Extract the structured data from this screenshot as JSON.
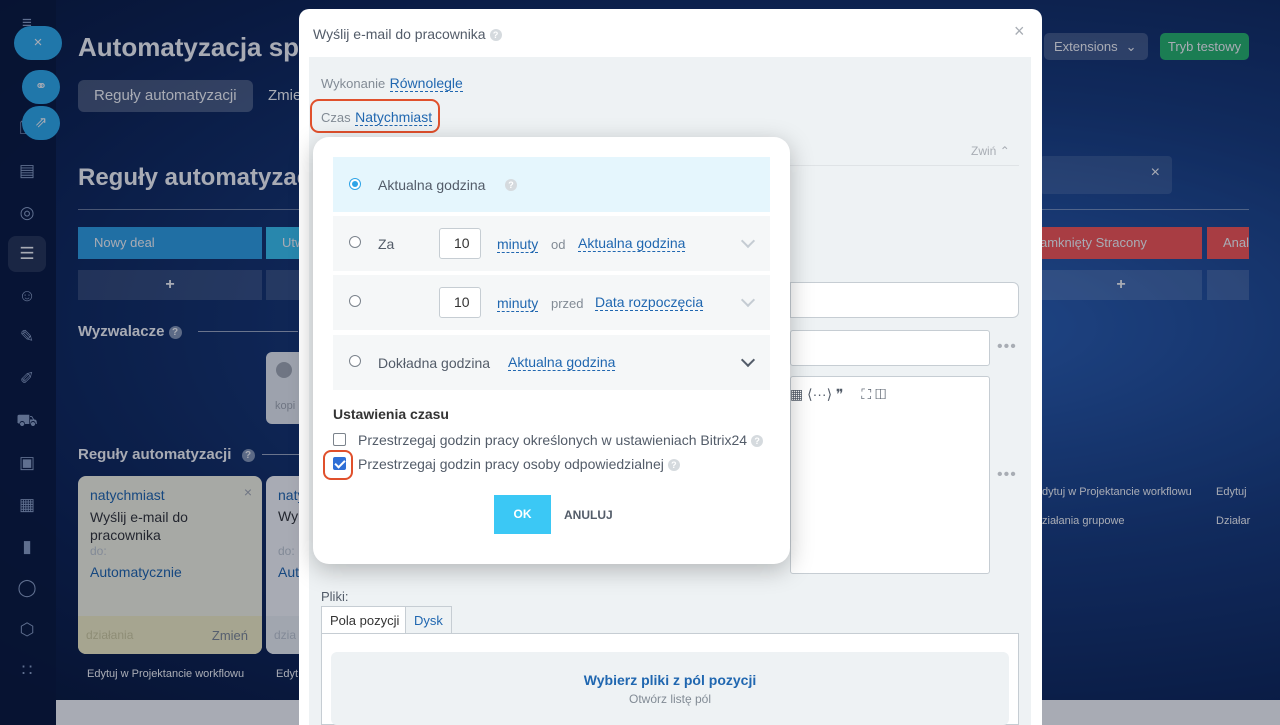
{
  "background_page": {
    "app_title": "Automatyzacja sprz",
    "tabs": [
      "Reguły automatyzacji",
      "Zmie"
    ],
    "section_title": "Reguły automatyzac",
    "stages": [
      {
        "label": "Nowy deal",
        "color": "#2fa4e7"
      },
      {
        "label": "Utw",
        "color": "#3bc8f5"
      },
      {
        "label": "amknięty Stracony",
        "color": "#ff5752"
      },
      {
        "label": "Anal",
        "color": "#ff5752"
      }
    ],
    "plus": "+",
    "triggers_label": "Wyzwalacze",
    "trigger_card_text": "kopi",
    "rules_label": "Reguły automatyzacji",
    "rule_cards": [
      {
        "timing": "natychmiast",
        "title": "Wyślij e-mail do pracownika",
        "to_label": "do:",
        "to_value": "Automatycznie",
        "foot_left": "działania",
        "foot_right": "Zmień"
      },
      {
        "timing": "naty",
        "title": "Wy",
        "to_label": "do:",
        "to_value": "Aut",
        "foot_left": "dzia",
        "foot_right": ""
      }
    ],
    "edit_workflow_link": "Edytuj w Projektancie workflowu",
    "edit_short": "Edyt",
    "right_edit_workflow": "dytuj w Projektancie workflowu",
    "right_edit": "Edytuj",
    "right_group": "ziałania grupowe",
    "right_group2": "Działar",
    "extensions_label": "Extensions",
    "test_mode_label": "Tryb testowy",
    "close_x": "×"
  },
  "modal": {
    "title": "Wyślij e-mail do pracownika",
    "close": "×",
    "execution_key": "Wykonanie",
    "execution_value": "Równolegle",
    "time_key": "Czas",
    "time_value": "Natychmiast",
    "collapse": "Zwiń",
    "dots": "•••",
    "editor_toolbar": "▦ ⟨···⟩ ❞",
    "editor_toolbar2": "⛶ ◫",
    "files_label": "Pliki:",
    "file_tabs": [
      "Pola pozycji",
      "Dysk"
    ],
    "files_title": "Wybierz pliki z pól pozycji",
    "files_sub": "Otwórz listę pól"
  },
  "time_popup": {
    "options": [
      {
        "label": "Aktualna godzina",
        "selected": true
      },
      {
        "prefix": "Za",
        "value": "10",
        "unit": "minuty",
        "relation": "od",
        "base": "Aktualna godzina",
        "selected": false
      },
      {
        "prefix": "",
        "value": "10",
        "unit": "minuty",
        "relation": "przed",
        "base": "Data rozpoczęcia",
        "selected": false
      },
      {
        "label": "Dokładna godzina",
        "base": "Aktualna godzina",
        "selected": false
      }
    ],
    "settings_title": "Ustawienia czasu",
    "checkboxes": [
      {
        "label": "Przestrzegaj godzin pracy określonych w ustawieniach Bitrix24",
        "checked": false
      },
      {
        "label": "Przestrzegaj godzin pracy osoby odpowiedzialnej",
        "checked": true
      }
    ],
    "ok_label": "OK",
    "cancel_label": "ANULUJ"
  },
  "colors": {
    "accent_blue": "#2067b0",
    "ok_button": "#3bc8f5",
    "test_button": "#27b96a",
    "highlight_ring": "#e0502c"
  }
}
